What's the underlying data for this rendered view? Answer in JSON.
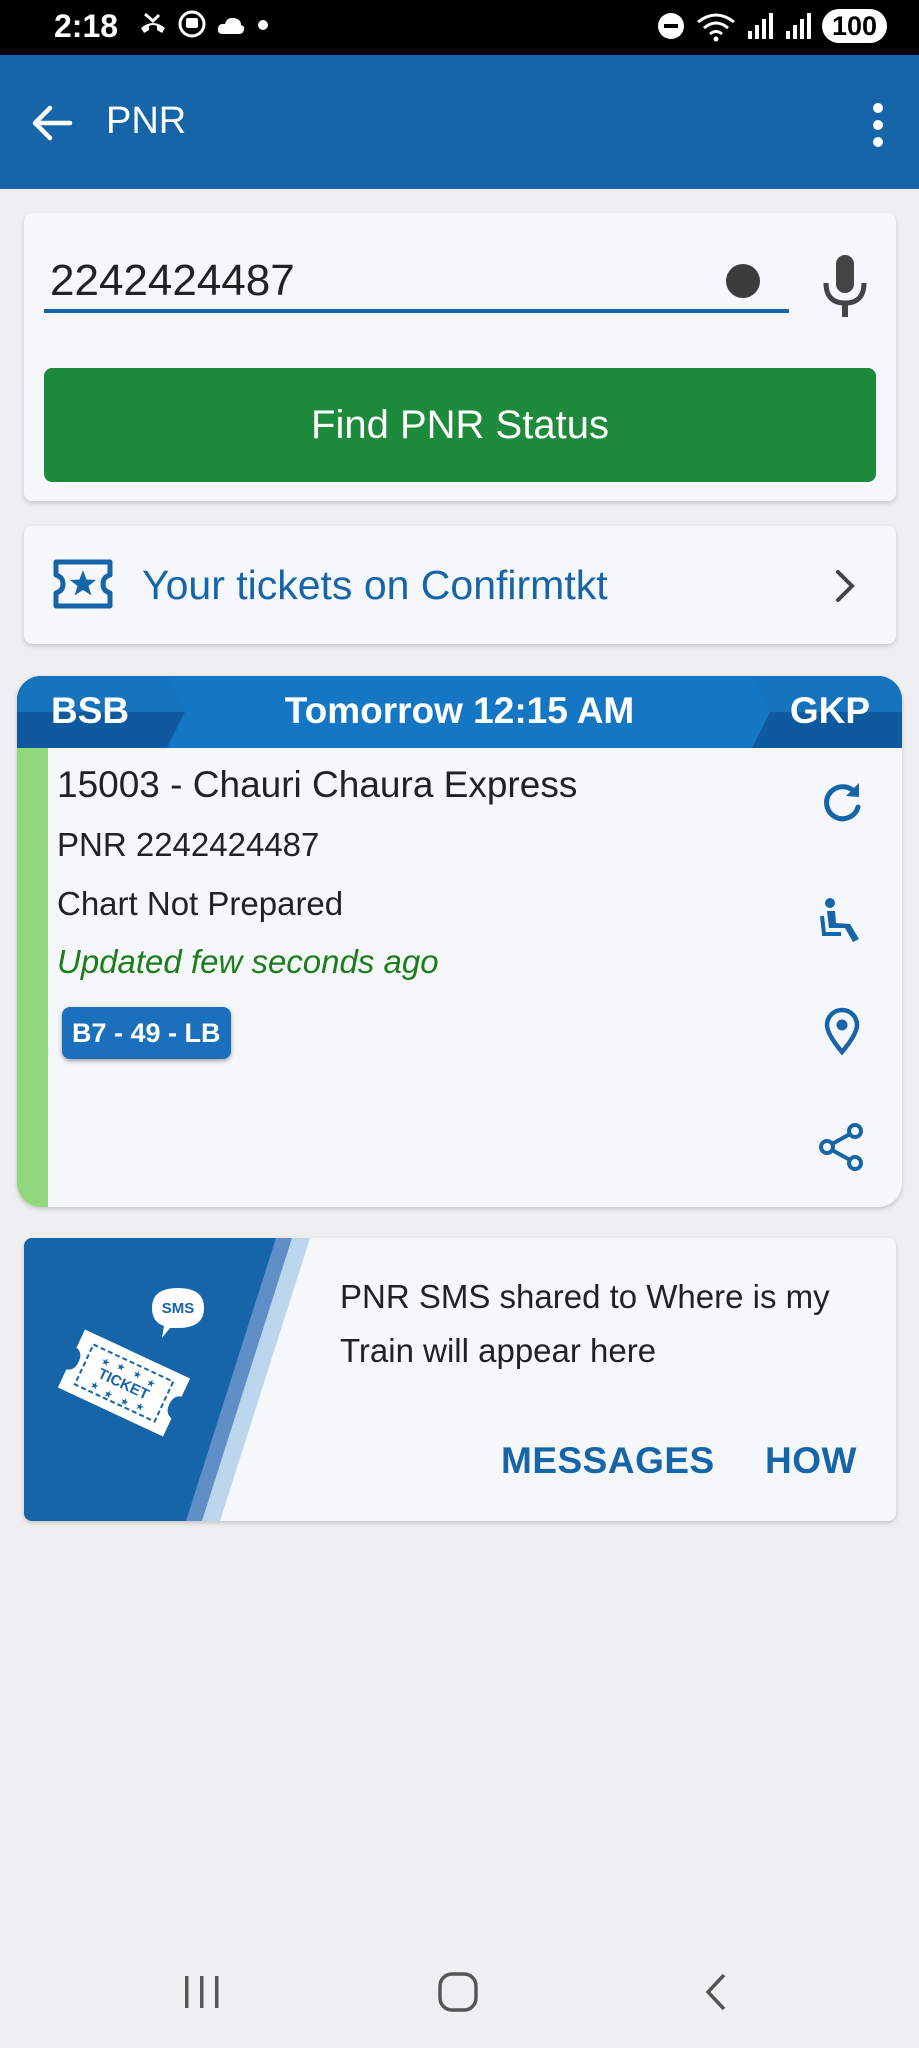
{
  "status_bar": {
    "time": "2:18",
    "battery": "100",
    "icons": [
      "missed-call-icon",
      "bus-icon",
      "cloud-icon",
      "dot-icon",
      "dnd-icon",
      "wifi-icon",
      "signal-icon",
      "signal-icon"
    ]
  },
  "app_bar": {
    "title": "PNR",
    "icons": [
      "back-arrow-icon",
      "more-vert-icon"
    ]
  },
  "search": {
    "value": "2242424487",
    "button_label": "Find PNR Status",
    "icons": [
      "clear-dot-icon",
      "mic-icon"
    ]
  },
  "tickets_link": {
    "label": "Your tickets on Confirmtkt",
    "icons": [
      "ticket-star-icon",
      "chevron-right-icon"
    ]
  },
  "pnr_card": {
    "from": "BSB",
    "to": "GKP",
    "departure": "Tomorrow 12:15 AM",
    "train": "15003 - Chauri Chaura Express",
    "pnr": "PNR 2242424487",
    "chart_status": "Chart Not Prepared",
    "updated": "Updated few seconds ago",
    "seat": "B7 - 49 - LB",
    "actions": [
      "refresh-icon",
      "seat-icon",
      "location-pin-icon",
      "share-icon"
    ],
    "colors": {
      "route_bar": "#1577c4",
      "status_strip": "#8fd87e",
      "updated_text": "#1d7d1d"
    }
  },
  "sms_promo": {
    "text": "PNR SMS shared to Where is my Train will appear here",
    "art_ticket_text": "TICKET",
    "art_bubble_text": "SMS",
    "messages_label": "MESSAGES",
    "how_label": "HOW"
  },
  "nav_bar": {
    "icons": [
      "recent-apps-icon",
      "home-icon",
      "back-icon"
    ]
  },
  "colors": {
    "primary": "#1565a8",
    "button_green": "#1e8b3c",
    "background": "#efeff1"
  }
}
